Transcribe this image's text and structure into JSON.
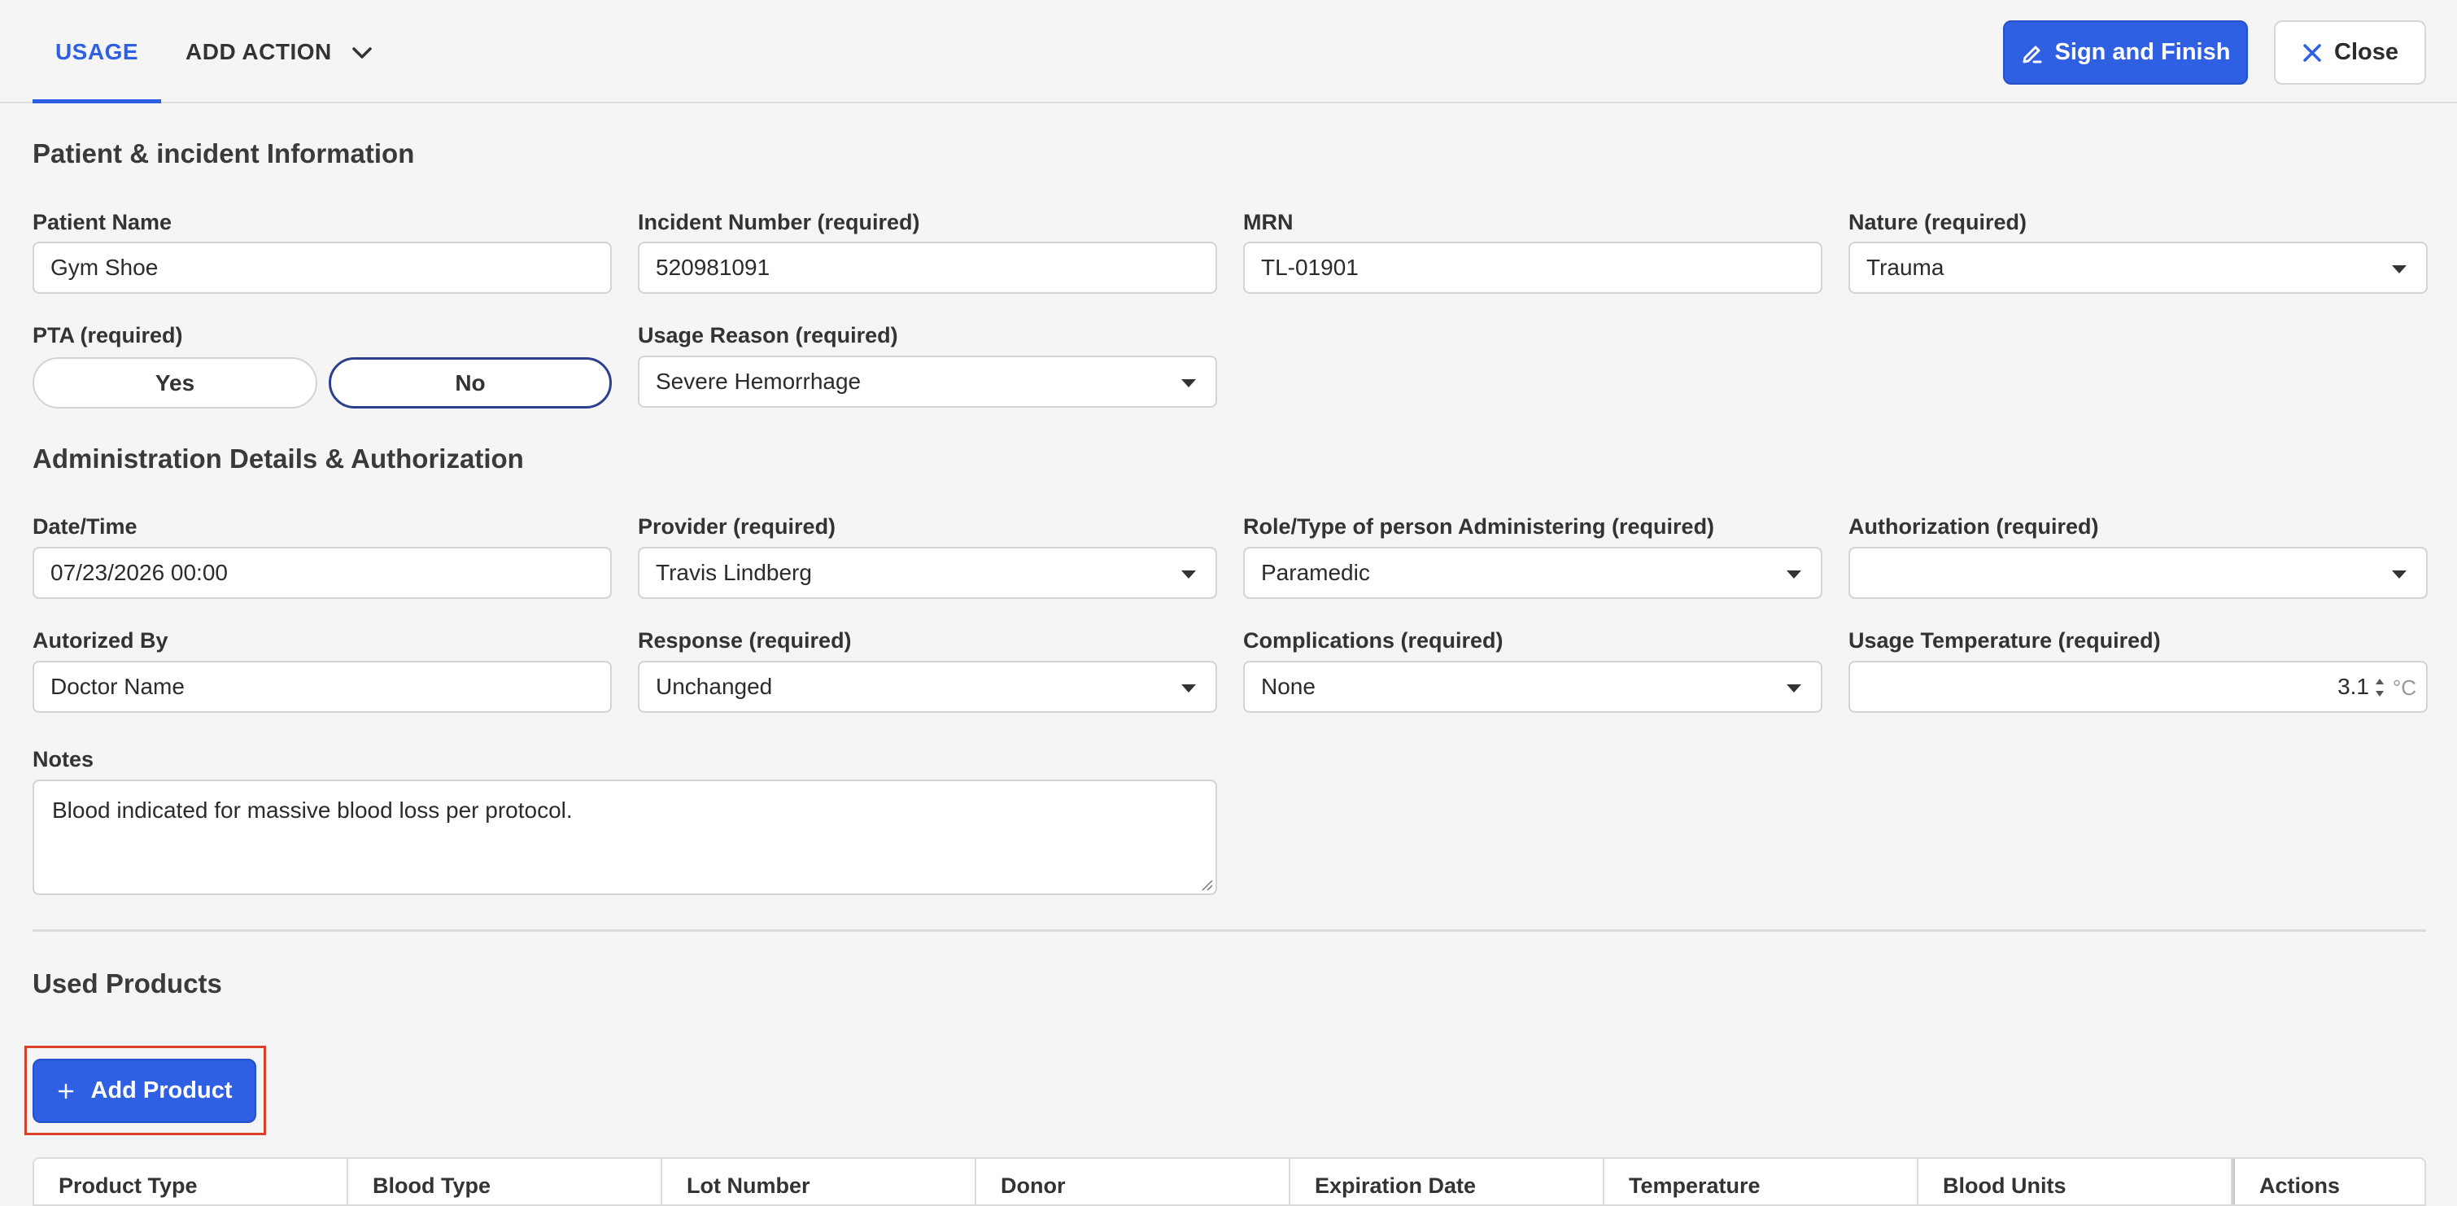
{
  "header": {
    "tabs": [
      {
        "label": "USAGE",
        "active": true
      },
      {
        "label": "ADD ACTION",
        "active": false
      }
    ],
    "sign_label": "Sign and Finish",
    "close_label": "Close"
  },
  "patient": {
    "section_title": "Patient & incident Information",
    "patient_name": {
      "label": "Patient Name",
      "value": "Gym Shoe"
    },
    "incident_number": {
      "label": "Incident Number (required)",
      "value": "520981091"
    },
    "mrn": {
      "label": "MRN",
      "value": "TL-01901"
    },
    "nature": {
      "label": "Nature (required)",
      "value": "Trauma"
    },
    "pta": {
      "label": "PTA (required)",
      "options": [
        "Yes",
        "No"
      ],
      "selected": "No"
    },
    "usage_reason": {
      "label": "Usage Reason (required)",
      "value": "Severe Hemorrhage"
    }
  },
  "admin": {
    "section_title": "Administration Details & Authorization",
    "datetime": {
      "label": "Date/Time",
      "value": "07/23/2026 00:00"
    },
    "provider": {
      "label": "Provider (required)",
      "value": "Travis Lindberg"
    },
    "role": {
      "label": "Role/Type of person Administering (required)",
      "value": "Paramedic"
    },
    "authorization": {
      "label": "Authorization (required)",
      "value": ""
    },
    "authorized_by": {
      "label": "Autorized By",
      "value": "Doctor Name"
    },
    "response": {
      "label": "Response (required)",
      "value": "Unchanged"
    },
    "complications": {
      "label": "Complications (required)",
      "value": "None"
    },
    "usage_temp": {
      "label": "Usage Temperature (required)",
      "value": "3.1",
      "unit": "°C"
    },
    "notes": {
      "label": "Notes",
      "value": "Blood indicated for massive blood loss per protocol."
    }
  },
  "products": {
    "section_title": "Used Products",
    "add_label": "Add Product",
    "columns": [
      "Product Type",
      "Blood Type",
      "Lot Number",
      "Donor",
      "Expiration Date",
      "Temperature",
      "Blood Units",
      "Actions"
    ]
  },
  "colors": {
    "accent": "#2f5fe3",
    "highlight": "#d9412b"
  }
}
